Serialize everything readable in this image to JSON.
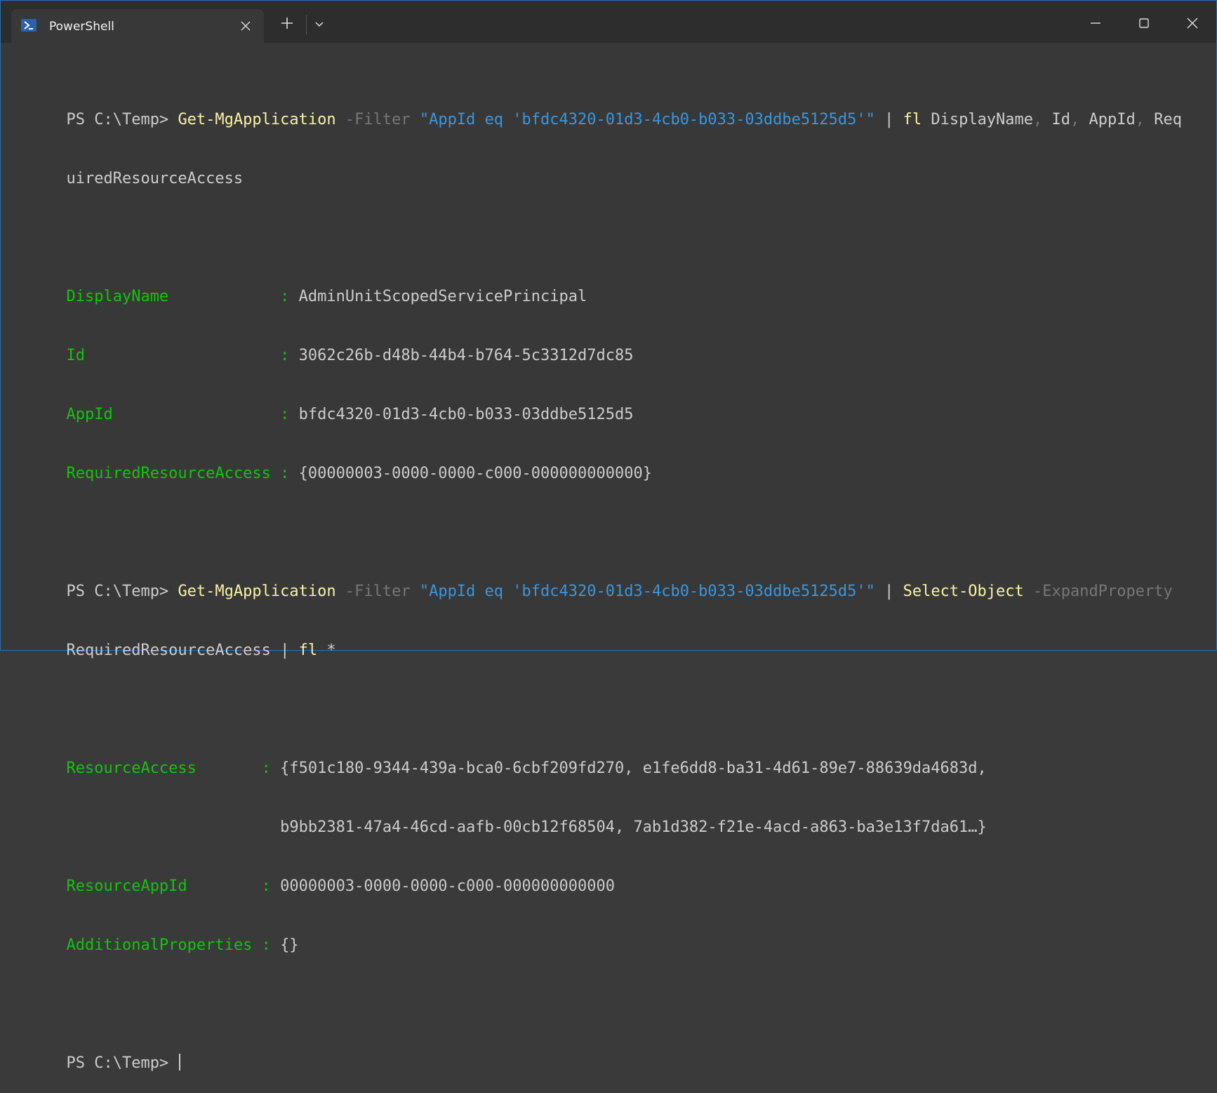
{
  "tab": {
    "title": "PowerShell"
  },
  "terminal": {
    "lines": [
      [
        "PS C:\\Temp> ",
        "Get-MgApplication",
        " ",
        "-Filter",
        " ",
        "\"AppId eq 'bfdc4320-01d3-4cb0-b033-03ddbe5125d5'\"",
        " | ",
        "fl",
        " DisplayName",
        ",",
        " Id",
        ",",
        " AppId",
        ",",
        " Req"
      ],
      [
        "uiredResourceAccess"
      ],
      [],
      [
        "DisplayName            ",
        ": ",
        "AdminUnitScopedServicePrincipal"
      ],
      [
        "Id                     ",
        ": ",
        "3062c26b-d48b-44b4-b764-5c3312d7dc85"
      ],
      [
        "AppId                  ",
        ": ",
        "bfdc4320-01d3-4cb0-b033-03ddbe5125d5"
      ],
      [
        "RequiredResourceAccess ",
        ": ",
        "{00000003-0000-0000-c000-000000000000}"
      ],
      [],
      [
        "PS C:\\Temp> ",
        "Get-MgApplication",
        " ",
        "-Filter",
        " ",
        "\"AppId eq 'bfdc4320-01d3-4cb0-b033-03ddbe5125d5'\"",
        " | ",
        "Select-Object",
        " ",
        "-ExpandProperty"
      ],
      [
        "RequiredResourceAccess | ",
        "fl",
        " *"
      ],
      [],
      [
        "ResourceAccess       ",
        ": ",
        "{f501c180-9344-439a-bca0-6cbf209fd270, e1fe6dd8-ba31-4d61-89e7-88639da4683d,"
      ],
      [
        "                       ",
        "b9bb2381-47a4-46cd-aafb-00cb12f68504, 7ab1d382-f21e-4acd-a863-ba3e13f7da61…}"
      ],
      [
        "ResourceAppId        ",
        ": ",
        "00000003-0000-0000-c000-000000000000"
      ],
      [
        "AdditionalProperties ",
        ": ",
        "{}"
      ],
      [],
      [
        "PS C:\\Temp> "
      ]
    ]
  }
}
